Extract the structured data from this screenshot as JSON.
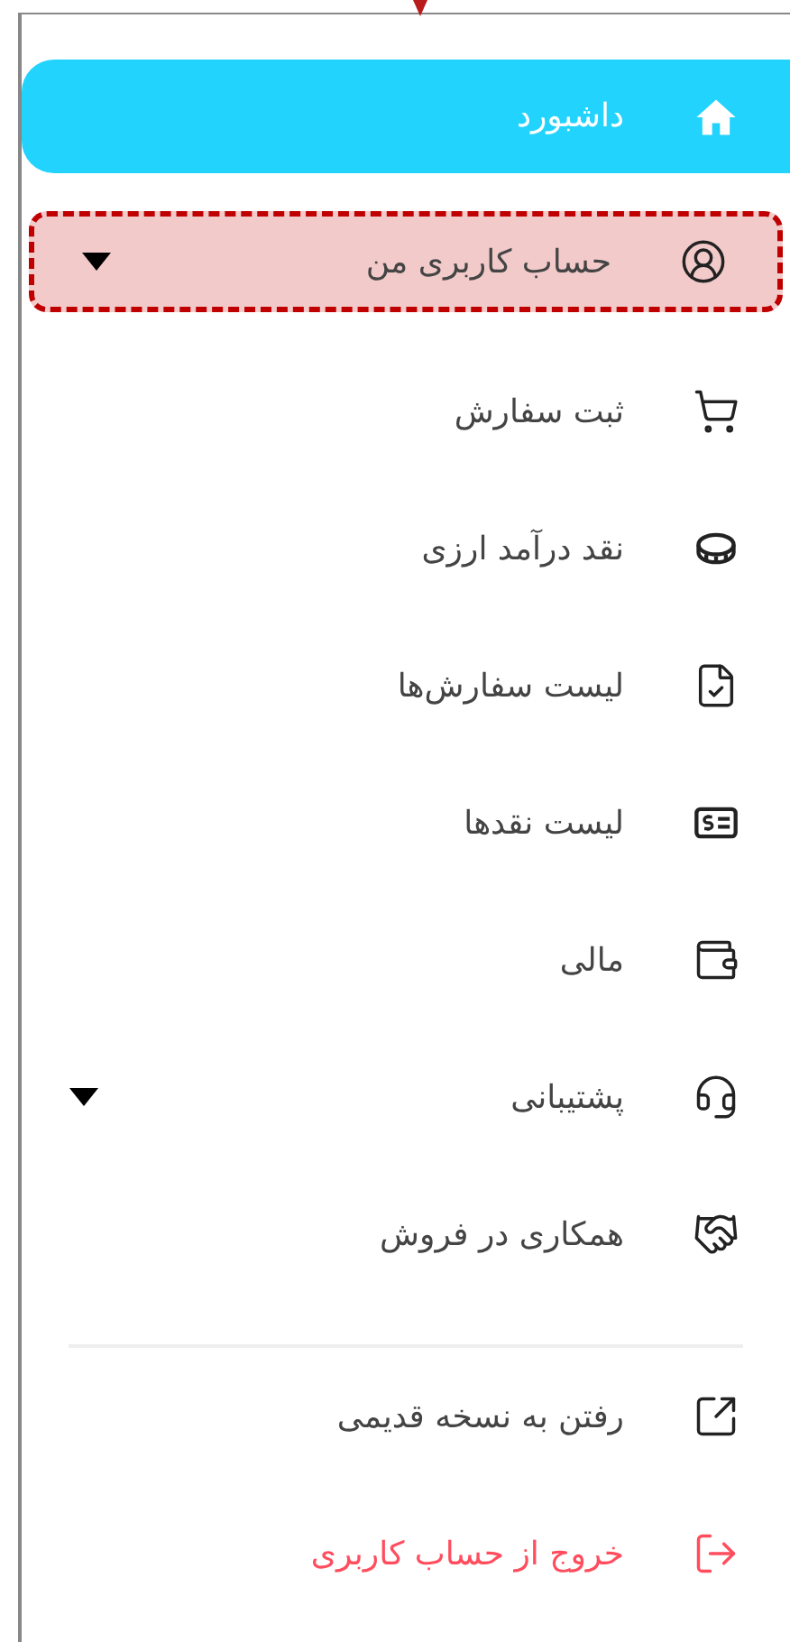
{
  "menu": {
    "items": [
      {
        "label": "داشبورد",
        "selected": true,
        "highlighted": false,
        "has_submenu": false
      },
      {
        "label": "حساب کاربری من",
        "selected": false,
        "highlighted": true,
        "has_submenu": true
      },
      {
        "label": "ثبت سفارش",
        "selected": false,
        "highlighted": false,
        "has_submenu": false
      },
      {
        "label": "نقد درآمد ارزی",
        "selected": false,
        "highlighted": false,
        "has_submenu": false
      },
      {
        "label": "لیست سفارش‌ها",
        "selected": false,
        "highlighted": false,
        "has_submenu": false
      },
      {
        "label": "لیست نقدها",
        "selected": false,
        "highlighted": false,
        "has_submenu": false
      },
      {
        "label": "مالی",
        "selected": false,
        "highlighted": false,
        "has_submenu": false
      },
      {
        "label": "پشتیبانی",
        "selected": false,
        "highlighted": false,
        "has_submenu": true
      },
      {
        "label": "همکاری در فروش",
        "selected": false,
        "highlighted": false,
        "has_submenu": false
      }
    ],
    "footer_items": [
      {
        "label": "رفتن به نسخه قدیمی",
        "kind": "link"
      },
      {
        "label": "خروج از حساب کاربری",
        "kind": "logout"
      }
    ]
  }
}
